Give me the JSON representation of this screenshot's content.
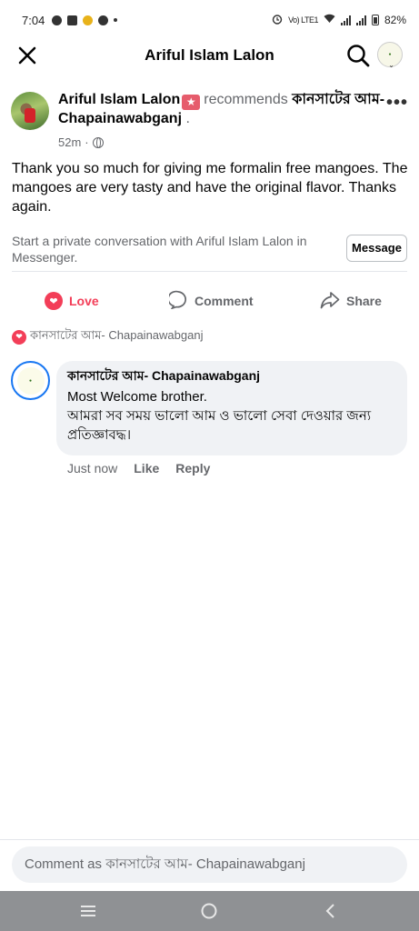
{
  "status_bar": {
    "time": "7:04",
    "network_label": "Vo) LTE1",
    "battery": "82%"
  },
  "header": {
    "title": "Ariful Islam Lalon"
  },
  "post": {
    "author": "Ariful Islam Lalon",
    "verb": "recommends",
    "page": "কানসাটের আম- Chapainawabganj",
    "page_suffix": " .",
    "time": "52m",
    "separator": " · ",
    "text": "Thank you so much for giving me formalin free mangoes. The mangoes are very tasty and have the original flavor. Thanks again.",
    "messenger_prompt": "Start a private conversation with Ariful Islam Lalon in Messenger.",
    "message_button": "Message"
  },
  "actions": {
    "love": "Love",
    "comment": "Comment",
    "share": "Share"
  },
  "reactions": {
    "reactor": "কানসাটের আম-  Chapainawabganj"
  },
  "comment": {
    "author": "কানসাটের আম-  Chapainawabganj",
    "line1": "Most Welcome brother.",
    "line2": "আমরা সব সময় ভালো আম ও ভালো সেবা দেওয়ার জন্য প্রতিজ্ঞাবদ্ধ।",
    "time": "Just now",
    "like": "Like",
    "reply": "Reply"
  },
  "composer": {
    "placeholder": "Comment as কানসাটের আম-  Chapainawabganj"
  },
  "colors": {
    "love": "#f33e58",
    "secondary_text": "#65676b",
    "bubble": "#f0f2f5",
    "accent_blue": "#1877f2",
    "nav_bar": "#8f9194"
  },
  "icons": [
    "messenger-icon",
    "binance-icon",
    "recycle-icon",
    "alarm-icon",
    "wifi-icon",
    "signal-icon",
    "battery-icon",
    "close-icon",
    "search-icon",
    "star-badge-icon",
    "globe-icon",
    "more-icon",
    "heart-icon",
    "comment-icon",
    "share-icon",
    "menu-icon",
    "home-icon",
    "back-icon"
  ]
}
